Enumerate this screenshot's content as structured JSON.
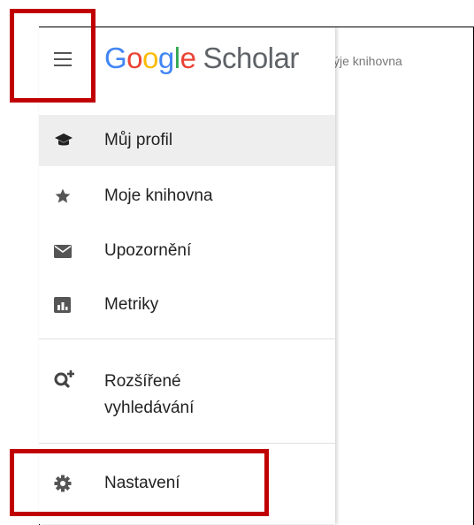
{
  "behind": {
    "text": "ýje knihovna"
  },
  "header": {
    "logo_letters": [
      {
        "ch": "G",
        "color": "#4285F4"
      },
      {
        "ch": "o",
        "color": "#EA4335"
      },
      {
        "ch": "o",
        "color": "#FBBC05"
      },
      {
        "ch": "g",
        "color": "#4285F4"
      },
      {
        "ch": "l",
        "color": "#34A853"
      },
      {
        "ch": "e",
        "color": "#EA4335"
      }
    ],
    "logo_suffix": "Scholar"
  },
  "menu": {
    "profile": "Můj profil",
    "library": "Moje knihovna",
    "alerts": "Upozornění",
    "metrics": "Metriky",
    "advanced_line1": "Rozšířené",
    "advanced_line2": "vyhledávání",
    "settings": "Nastavení"
  },
  "colors": {
    "active_bg": "#eeeeee",
    "callout": "#c00000",
    "icon": "#555555"
  }
}
